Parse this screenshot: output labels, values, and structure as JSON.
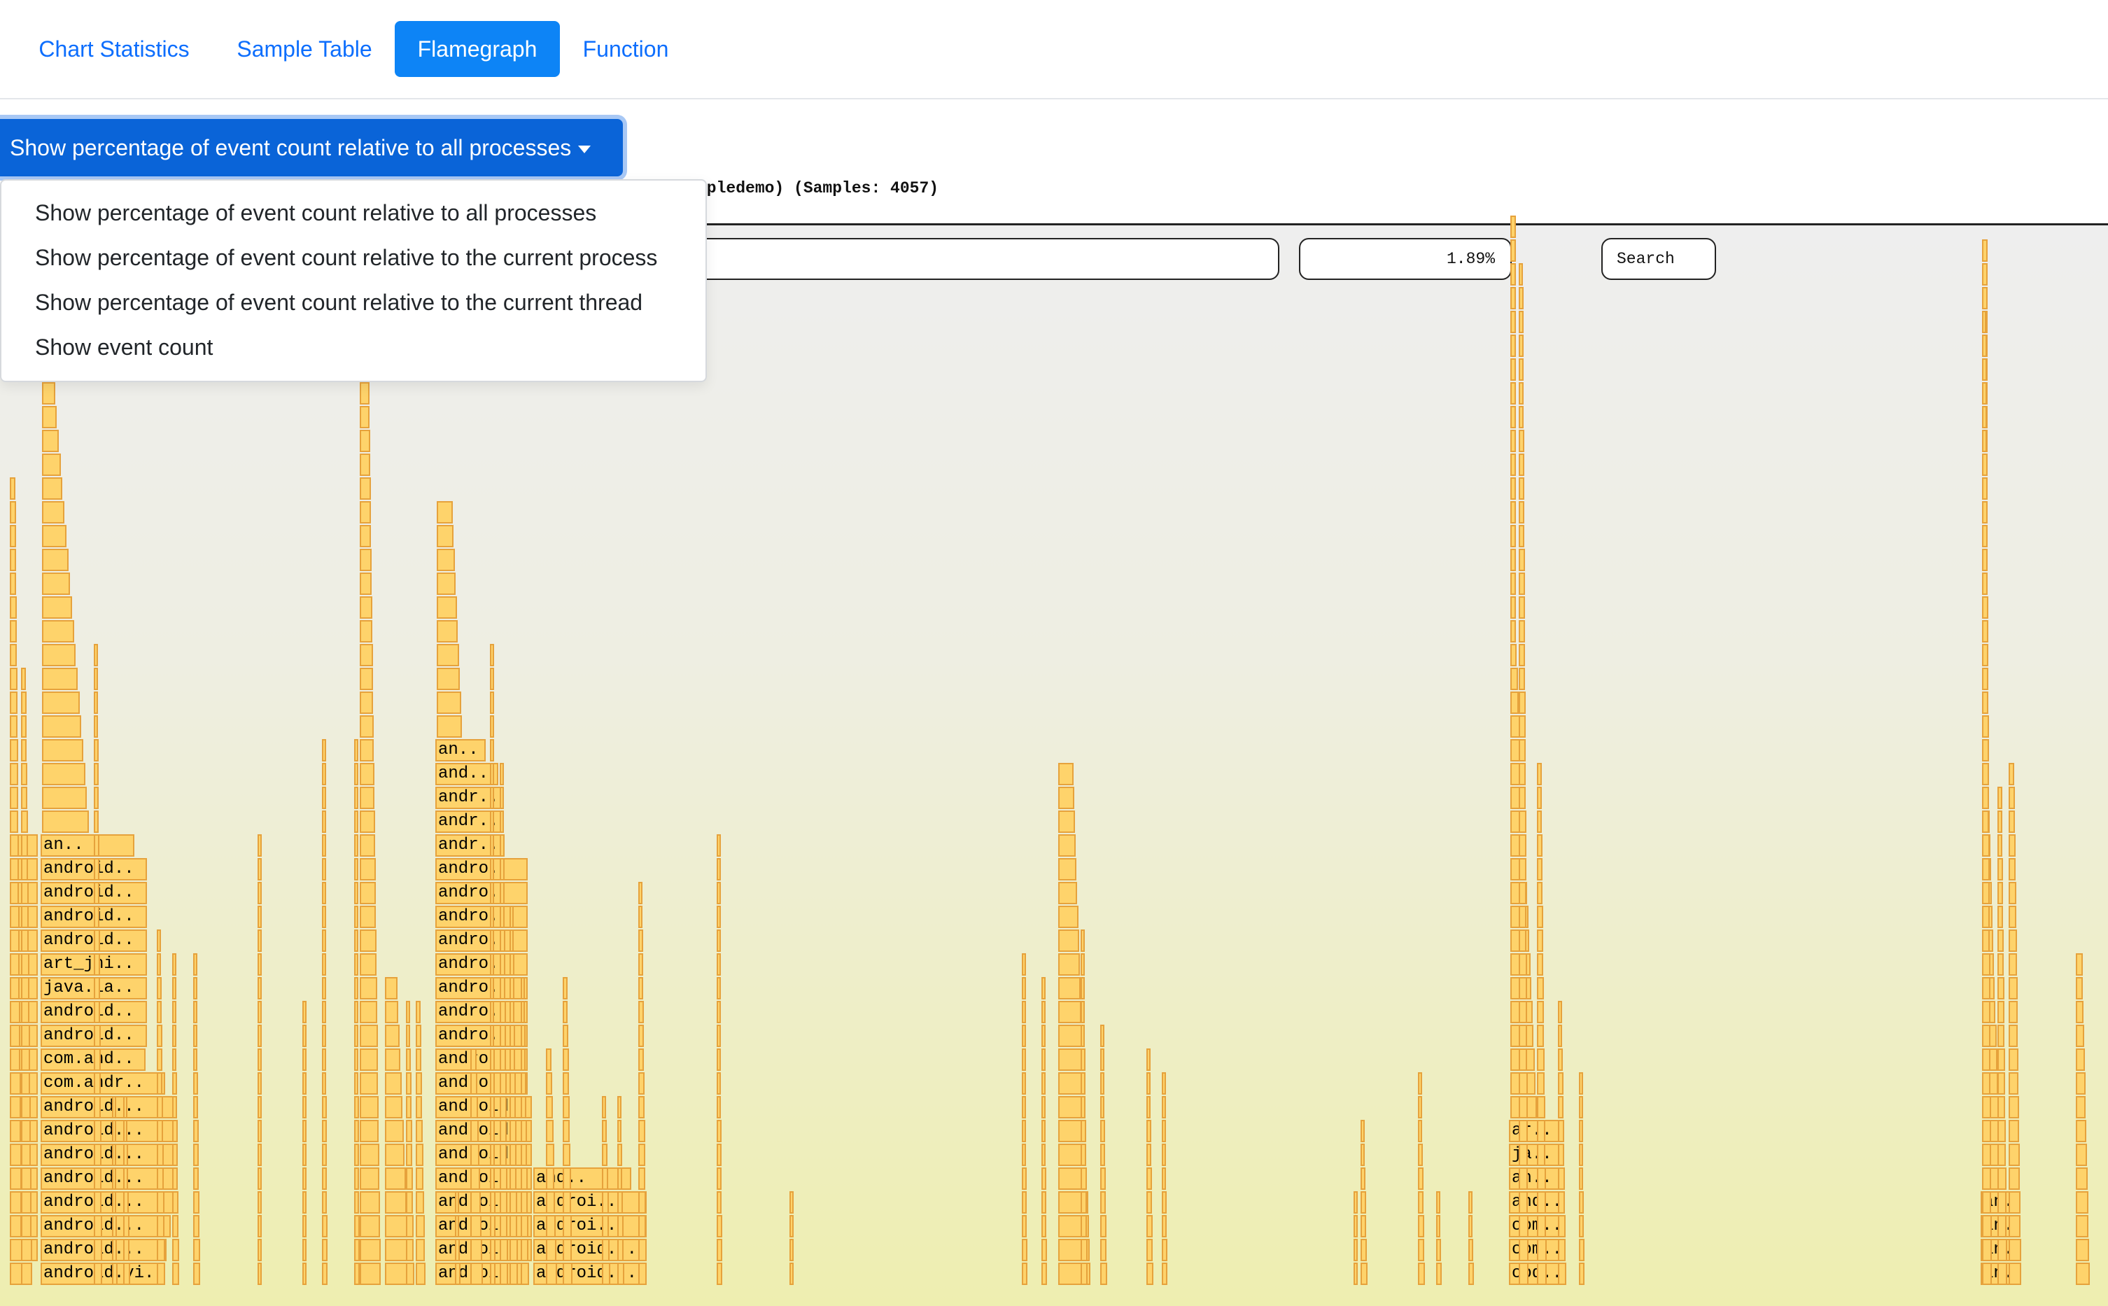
{
  "nav": {
    "tabs": [
      {
        "label": "Chart Statistics",
        "active": false
      },
      {
        "label": "Sample Table",
        "active": false
      },
      {
        "label": "Flamegraph",
        "active": true
      },
      {
        "label": "Function",
        "active": false
      }
    ]
  },
  "dropdown": {
    "selected": "Show percentage of event count relative to all processes",
    "options": [
      "Show percentage of event count relative to all processes",
      "Show percentage of event count relative to the current process",
      "Show percentage of event count relative to the current thread",
      "Show event count"
    ]
  },
  "flamegraph": {
    "title": "mpledemo) (Samples: 4057)",
    "search_value": "",
    "percent_value": "1.89%",
    "search_button_label": "Search",
    "colors": {
      "frame_fill": "#fed36b",
      "frame_border": "#e6a23c"
    },
    "columns": [
      {
        "labels": [
          "android.vi..",
          "android...",
          "android...",
          "android...",
          "android...",
          "android...",
          "android...",
          "android...",
          "com.andr..",
          "com.and..",
          "android..",
          "android..",
          "java.la..",
          "art_jni..",
          "android..",
          "android..",
          "android..",
          "android..",
          "an.."
        ],
        "tail": 21
      },
      {
        "labels": [
          "android...",
          "android..",
          "android..",
          "android..",
          "android..",
          "android..",
          "android..",
          "android..",
          "andro..",
          "andro..",
          "andro..",
          "andro..",
          "andro..",
          "andro..",
          "andro..",
          "andro..",
          "andro..",
          "andro..",
          "andr..",
          "andr..",
          "andr..",
          "and..",
          "an.."
        ],
        "tail": 10
      },
      {
        "labels": [
          "android...",
          "android...",
          "androi..",
          "androi..",
          "and.."
        ],
        "tail": 0
      },
      {
        "labels": [
          "cod..",
          "com..",
          "com..",
          "and..",
          "an..",
          "ja..",
          "ar.."
        ],
        "tail": 38
      },
      {
        "labels": [
          "an..",
          "an..",
          "an..",
          "an.."
        ],
        "tail": 40
      }
    ]
  }
}
